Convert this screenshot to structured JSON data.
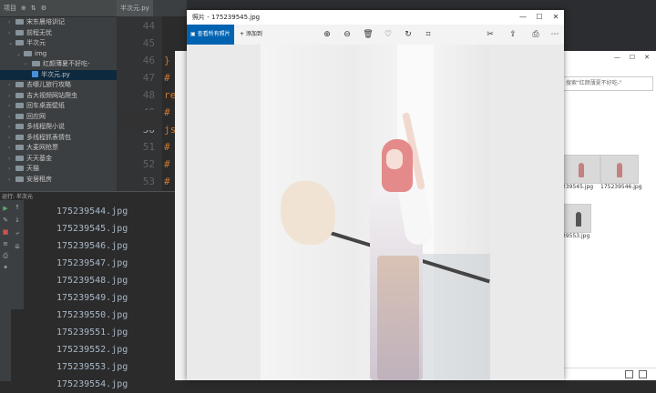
{
  "ide": {
    "project_header": [
      "项目",
      "⊕",
      "⇅",
      "⚙"
    ],
    "tree": [
      {
        "label": "宋东晨培训记",
        "indent": 1,
        "type": "folder",
        "arrow": "›"
      },
      {
        "label": "前程无忧",
        "indent": 1,
        "type": "folder",
        "arrow": "›"
      },
      {
        "label": "半次元",
        "indent": 1,
        "type": "folder",
        "arrow": "⌄"
      },
      {
        "label": "img",
        "indent": 2,
        "type": "folder",
        "arrow": "⌄"
      },
      {
        "label": "红颜薄夏不好吃-",
        "indent": 3,
        "type": "folder",
        "arrow": "›"
      },
      {
        "label": "半次元.py",
        "indent": 3,
        "type": "file",
        "arrow": ""
      },
      {
        "label": "去哪儿旅行攻略",
        "indent": 1,
        "type": "folder",
        "arrow": "›"
      },
      {
        "label": "吉大视频网站爬虫",
        "indent": 1,
        "type": "folder",
        "arrow": "›"
      },
      {
        "label": "回车桌面壁纸",
        "indent": 1,
        "type": "folder",
        "arrow": "›"
      },
      {
        "label": "回应网",
        "indent": 1,
        "type": "folder",
        "arrow": "›"
      },
      {
        "label": "多线程爬小说",
        "indent": 1,
        "type": "folder",
        "arrow": "›"
      },
      {
        "label": "多线程抓表情包",
        "indent": 1,
        "type": "folder",
        "arrow": "›"
      },
      {
        "label": "大麦网抢票",
        "indent": 1,
        "type": "folder",
        "arrow": "›"
      },
      {
        "label": "天天基金",
        "indent": 1,
        "type": "folder",
        "arrow": "›"
      },
      {
        "label": "天猫",
        "indent": 1,
        "type": "folder",
        "arrow": "›"
      },
      {
        "label": "安居租房",
        "indent": 1,
        "type": "folder",
        "arrow": "›"
      }
    ],
    "editor_tab": "半次元.py",
    "line_numbers": [
      "44",
      "45",
      "46",
      "47",
      "48",
      "49",
      "50",
      "51",
      "52",
      "53"
    ],
    "current_line": "50",
    "code_tokens": [
      {
        "text": "}",
        "line": 2,
        "color": "#cc7832"
      },
      {
        "text": "#",
        "line": 3,
        "color": "#cc7832"
      },
      {
        "text": "re",
        "line": 4,
        "color": "#cc7832"
      },
      {
        "text": "#",
        "line": 5,
        "color": "#cc7832"
      },
      {
        "text": "js",
        "line": 6,
        "color": "#cc7832"
      },
      {
        "text": "#",
        "line": 7,
        "color": "#cc7832"
      },
      {
        "text": "#",
        "line": 8,
        "color": "#cc7832"
      },
      {
        "text": "#",
        "line": 9,
        "color": "#cc7832"
      }
    ],
    "run_tab": "运行:   半次元",
    "output_lines": [
      "175239544.jpg",
      "175239545.jpg",
      "175239546.jpg",
      "175239547.jpg",
      "175239548.jpg",
      "175239549.jpg",
      "175239550.jpg",
      "175239551.jpg",
      "175239552.jpg",
      "175239553.jpg",
      "175239554.jpg"
    ]
  },
  "photos_app": {
    "title": "照片 - 175239545.jpg",
    "window_controls": [
      "—",
      "☐",
      "✕"
    ],
    "see_all_label": "查看所有照片",
    "add_label": "+ 添加到",
    "toolbar_icons": [
      {
        "name": "zoom-in-icon",
        "glyph": "⊕"
      },
      {
        "name": "zoom-out-icon",
        "glyph": "⊖"
      },
      {
        "name": "delete-icon",
        "glyph": "🗑"
      },
      {
        "name": "heart-icon",
        "glyph": "♡"
      },
      {
        "name": "rotate-icon",
        "glyph": "↻"
      },
      {
        "name": "crop-icon",
        "glyph": "⌗"
      },
      {
        "name": "edit-create-icon",
        "glyph": "✂"
      },
      {
        "name": "share-icon",
        "glyph": "⇪"
      },
      {
        "name": "print-icon",
        "glyph": "⎙"
      },
      {
        "name": "more-icon",
        "glyph": "⋯"
      }
    ]
  },
  "explorer": {
    "window_controls": [
      "—",
      "☐",
      "✕"
    ],
    "search_placeholder": "搜索\"红颜薄夏不好吃-\"",
    "thumbnails": [
      {
        "label": "239545.jpg"
      },
      {
        "label": "175239546.jpg"
      },
      {
        "label": "39553.jpg"
      }
    ]
  }
}
